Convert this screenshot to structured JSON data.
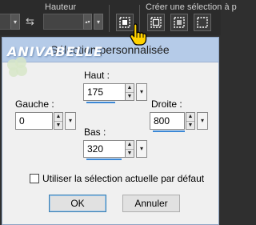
{
  "toolbar": {
    "height_label": "Hauteur",
    "create_selection_label": "Créer une sélection à p"
  },
  "dialog": {
    "watermark": "ANIVABELLE",
    "title": "Sélection personnalisée",
    "haut": {
      "label": "Haut :",
      "value": "175"
    },
    "gauche": {
      "label": "Gauche :",
      "value": "0"
    },
    "droite": {
      "label": "Droite :",
      "value": "800"
    },
    "bas": {
      "label": "Bas :",
      "value": "320"
    },
    "default_checkbox_label": "Utiliser la  sélection actuelle par défaut",
    "ok_label": "OK",
    "cancel_label": "Annuler"
  }
}
